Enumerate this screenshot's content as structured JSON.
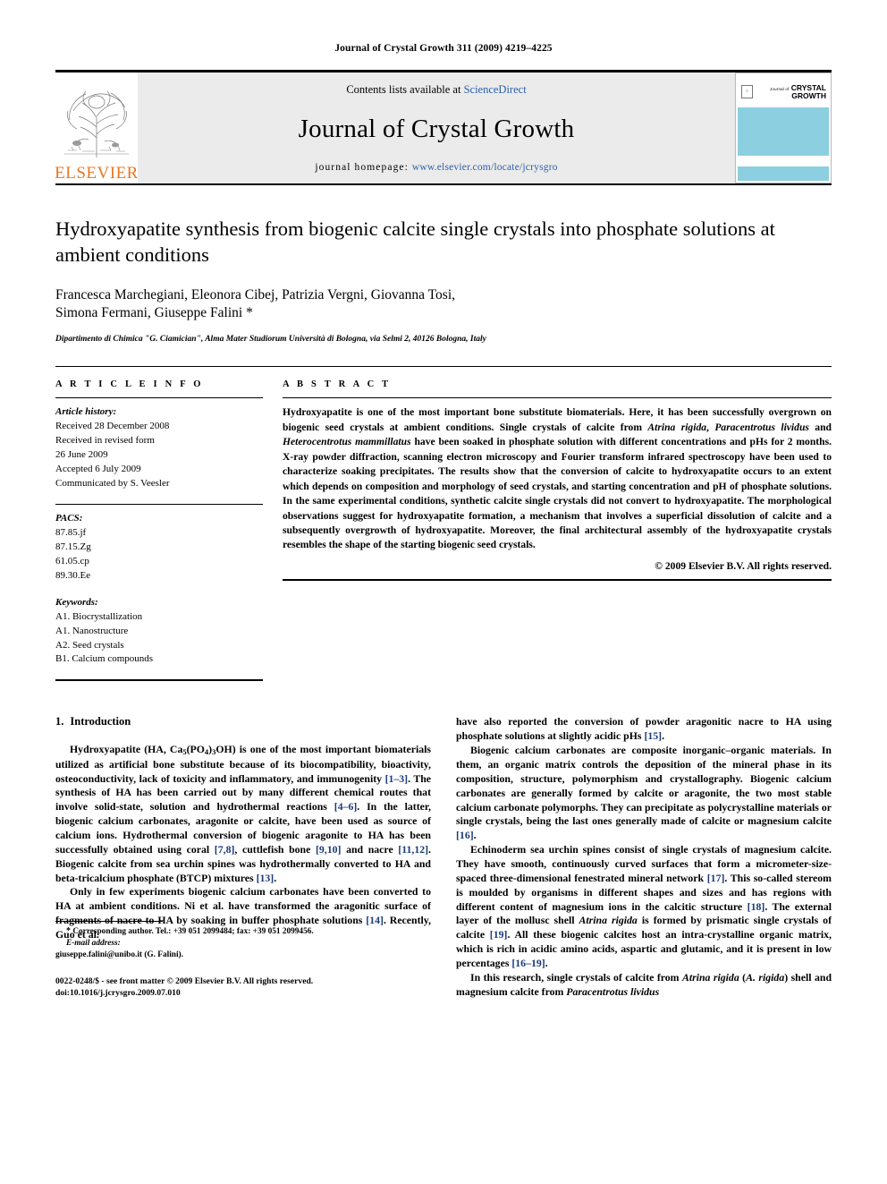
{
  "running_head": "Journal of Crystal Growth 311 (2009) 4219–4225",
  "masthead": {
    "contents_prefix": "Contents lists available at",
    "sciencedirect": "ScienceDirect",
    "journal_name": "Journal of Crystal Growth",
    "homepage_prefix": "journal homepage:",
    "homepage_url": "www.elsevier.com/locate/jcrysgro",
    "publisher": "ELSEVIER",
    "cover": {
      "pretitle": "Journal of",
      "line1": "CRYSTAL",
      "line2": "GROWTH"
    },
    "colors": {
      "link_blue": "#2b5faa",
      "elsevier_orange": "#E87722",
      "cover_blue": "#8ccfe0",
      "band_grey": "#ebebeb"
    }
  },
  "title": "Hydroxyapatite synthesis from biogenic calcite single crystals into phosphate solutions at ambient conditions",
  "authors": [
    "Francesca Marchegiani, Eleonora Cibej, Patrizia Vergni, Giovanna Tosi,",
    "Simona Fermani, Giuseppe Falini *"
  ],
  "affiliation": "Dipartimento di Chimica \"G. Ciamician\", Alma Mater Studiorum Università di Bologna, via Selmi 2, 40126 Bologna, Italy",
  "article_info": {
    "heading": "A R T I C L E   I N F O",
    "history_label": "Article history:",
    "history": [
      "Received 28 December 2008",
      "Received in revised form",
      "26 June 2009",
      "Accepted 6 July 2009",
      "Communicated by S. Veesler"
    ],
    "pacs_label": "PACS:",
    "pacs": [
      "87.85.jf",
      "87.15.Zg",
      "61.05.cp",
      "89.30.Ee"
    ],
    "keywords_label": "Keywords:",
    "keywords": [
      "A1. Biocrystallization",
      "A1. Nanostructure",
      "A2. Seed crystals",
      "B1. Calcium compounds"
    ]
  },
  "abstract": {
    "heading": "A B S T R A C T",
    "p1_a": "Hydroxyapatite is one of the most important bone substitute biomaterials. Here, it has been successfully overgrown on biogenic seed crystals at ambient conditions. Single crystals of calcite from ",
    "sp1": "Atrina rigida",
    "p1_b": ", ",
    "sp2": "Paracentrotus lividus",
    "p1_c": " and ",
    "sp3": "Heterocentrotus mammillatus",
    "p1_d": " have been soaked in phosphate solution with different concentrations and pHs for 2 months. X-ray powder diffraction, scanning electron microscopy and Fourier transform infrared spectroscopy have been used to characterize soaking precipitates. The results show that the conversion of calcite to hydroxyapatite occurs to an extent which depends on composition and morphology of seed crystals, and starting concentration and pH of phosphate solutions. In the same experimental conditions, synthetic calcite single crystals did not convert to hydroxyapatite. The morphological observations suggest for hydroxyapatite formation, a mechanism that involves a superficial dissolution of calcite and a subsequently overgrowth of hydroxyapatite. Moreover, the final architectural assembly of the hydroxyapatite crystals resembles the shape of the starting biogenic seed crystals.",
    "copyright": "© 2009 Elsevier B.V. All rights reserved."
  },
  "body": {
    "section_number": "1.",
    "section_title": "Introduction",
    "left": {
      "p1_a": "Hydroxyapatite (HA, Ca",
      "p1_sub1": "5",
      "p1_b": "(PO",
      "p1_sub2": "4",
      "p1_c": ")",
      "p1_sub3": "3",
      "p1_d": "OH) is one of the most important biomaterials utilized as artificial bone substitute because of its biocompatibility, bioactivity, osteoconductivity, lack of toxicity and inflammatory, and immunogenity ",
      "r1": "[1–3]",
      "p1_e": ". The synthesis of HA has been carried out by many different chemical routes that involve solid-state, solution and hydrothermal reactions ",
      "r2": "[4–6]",
      "p1_f": ". In the latter, biogenic calcium carbonates, aragonite or calcite, have been used as source of calcium ions. Hydrothermal conversion of biogenic aragonite to HA has been successfully obtained using coral ",
      "r3": "[7,8]",
      "p1_g": ", cuttlefish bone ",
      "r4": "[9,10]",
      "p1_h": " and nacre ",
      "r5": "[11,12]",
      "p1_i": ". Biogenic calcite from sea urchin spines was hydrothermally converted to HA and beta-tricalcium phosphate (BTCP) mixtures ",
      "r6": "[13]",
      "p1_j": ".",
      "p2_a": "Only in few experiments biogenic calcium carbonates have been converted to HA at ambient conditions. Ni et al. have transformed the aragonitic surface of fragments of nacre to HA by soaking in buffer phosphate solutions ",
      "r7": "[14]",
      "p2_b": ". Recently, Guo et al."
    },
    "right": {
      "p1_a": "have also reported the conversion of powder aragonitic nacre to HA using phosphate solutions at slightly acidic pHs ",
      "r1": "[15]",
      "p1_b": ".",
      "p2_a": "Biogenic calcium carbonates are composite inorganic–organic materials. In them, an organic matrix controls the deposition of the mineral phase in its composition, structure, polymorphism and crystallography. Biogenic calcium carbonates are generally formed by calcite or aragonite, the two most stable calcium carbonate polymorphs. They can precipitate as polycrystalline materials or single crystals, being the last ones generally made of calcite or magnesium calcite ",
      "r2": "[16]",
      "p2_b": ".",
      "p3_a": "Echinoderm sea urchin spines consist of single crystals of magnesium calcite. They have smooth, continuously curved surfaces that form a micrometer-size-spaced three-dimensional fenestrated mineral network ",
      "r3": "[17]",
      "p3_b": ". This so-called stereom is moulded by organisms in different shapes and sizes and has regions with different content of magnesium ions in the calcitic structure ",
      "r4": "[18]",
      "p3_c": ". The external layer of the mollusc shell ",
      "sp1": "Atrina rigida",
      "p3_d": " is formed by prismatic single crystals of calcite ",
      "r5": "[19]",
      "p3_e": ". All these biogenic calcites host an intra-crystalline organic matrix, which is rich in acidic amino acids, aspartic and glutamic, and it is present in low percentages ",
      "r6": "[16–19]",
      "p3_f": ".",
      "p4_a": "In this research, single crystals of calcite from ",
      "sp2": "Atrina rigida",
      "p4_b": " (",
      "sp3": "A. rigida",
      "p4_c": ") shell and magnesium calcite from ",
      "sp4": "Paracentrotus lividus"
    }
  },
  "footnote": {
    "star": "*",
    "corresponding": " Corresponding author. Tel.: +39 051 2099484; fax: +39 051 2099456.",
    "email_label": "E-mail address:",
    "email": "giuseppe.falini@unibo.it (G. Falini).",
    "issn_line1": "0022-0248/$ - see front matter © 2009 Elsevier B.V. All rights reserved.",
    "issn_line2": "doi:10.1016/j.jcrysgro.2009.07.010"
  }
}
